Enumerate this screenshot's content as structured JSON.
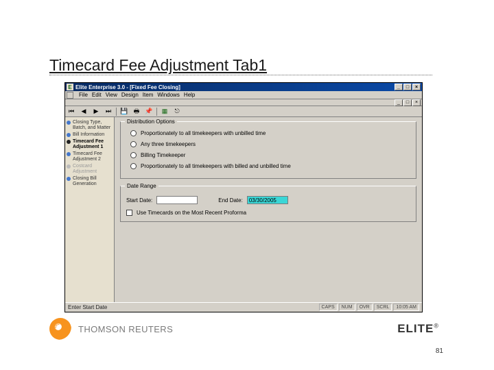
{
  "slide": {
    "title": "Timecard Fee Adjustment Tab1",
    "page_number": "81"
  },
  "window": {
    "title": "Elite Enterprise 3.0 - [Fixed Fee Closing]",
    "menu": {
      "file": "File",
      "edit": "Edit",
      "view": "View",
      "design": "Design",
      "item": "Item",
      "windows": "Windows",
      "help": "Help"
    },
    "sidebar": {
      "items": [
        {
          "label": "Closing Type, Batch, and Matter"
        },
        {
          "label": "Bill Information"
        },
        {
          "label": "Timecard Fee Adjustment 1"
        },
        {
          "label": "Timecard Fee Adjustment 2"
        },
        {
          "label": "Costcard Adjustment"
        },
        {
          "label": "Closing Bill Generation"
        }
      ]
    },
    "distribution": {
      "group_title": "Distribution Options",
      "opt1": "Proportionately to all timekeepers with unbilled time",
      "opt2": "Any three timekeepers",
      "opt3": "Billing Timekeeper",
      "opt4": "Proportionately to all timekeepers with billed and unbilled time"
    },
    "dates": {
      "group_title": "Date Range",
      "start_label": "Start Date:",
      "end_label": "End Date:",
      "end_value": "03/30/2005",
      "use_check": "Use Timecards on the Most Recent Proforma"
    },
    "status": {
      "left": "Enter Start Date",
      "caps": "CAPS",
      "num": "NUM",
      "ovr": "OVR",
      "scrl": "SCRL",
      "time": "10:05 AM"
    }
  },
  "footer": {
    "tr": "THOMSON REUTERS",
    "elite": "ELITE"
  }
}
